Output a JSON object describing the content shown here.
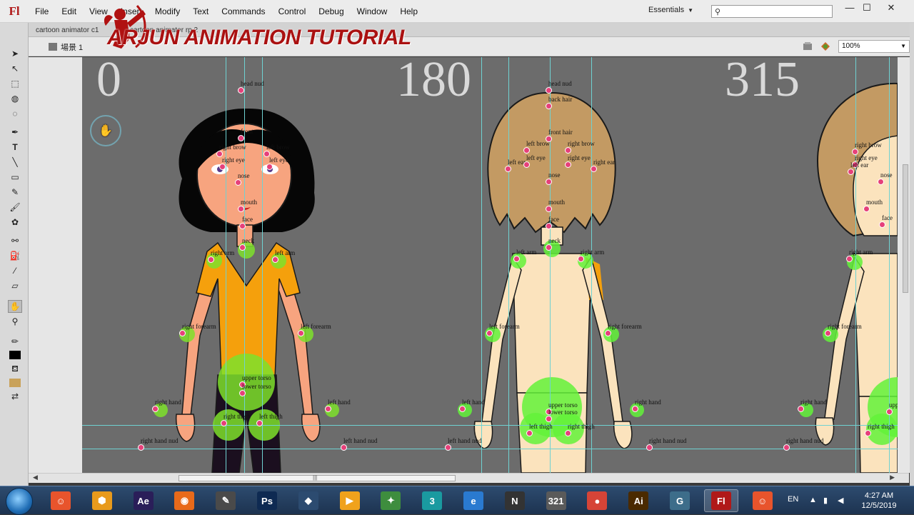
{
  "app": {
    "logo": "Fl"
  },
  "menu": [
    "File",
    "Edit",
    "View",
    "Insert",
    "Modify",
    "Text",
    "Commands",
    "Control",
    "Debug",
    "Window",
    "Help"
  ],
  "workspace": {
    "label": "Essentials"
  },
  "search": {
    "placeholder": ""
  },
  "window_controls": {
    "minimize": "—",
    "maximize": "☐",
    "close": "✕"
  },
  "doc_tabs": [
    "cartoon animator c1",
    "cartoon animator rp 2"
  ],
  "scene": {
    "label": "場景 1"
  },
  "zoom": {
    "value": "100%"
  },
  "watermark": {
    "text": "ARJUN ANIMATION TUTORIAL"
  },
  "stage": {
    "angles": [
      "0",
      "180",
      "315"
    ],
    "figures": [
      {
        "labels": [
          "head nud",
          "front",
          "right brow",
          "left brow",
          "right eye",
          "left eye",
          "nose",
          "mouth",
          "face",
          "neck",
          "right arm",
          "left arm",
          "right forearm",
          "left forearm",
          "upper torso",
          "lower torso",
          "right thigh",
          "left thigh",
          "right hand",
          "left hand",
          "right hand nud",
          "left hand nud"
        ]
      },
      {
        "labels": [
          "head nud",
          "back hair",
          "front hair",
          "left brow",
          "right brow",
          "left ear",
          "left eye",
          "right eye",
          "right ear",
          "nose",
          "mouth",
          "face",
          "neck",
          "left arm",
          "right arm",
          "left forearm",
          "right forearm",
          "upper torso",
          "lower torso",
          "left thigh",
          "right thigh",
          "left hand",
          "right hand",
          "left hand nud",
          "right hand nud"
        ]
      },
      {
        "labels": [
          "right brow",
          "right eye",
          "left ear",
          "nose",
          "mouth",
          "face",
          "right arm",
          "right forearm",
          "right hand",
          "right hand nud",
          "right thigh",
          "upper torso"
        ]
      }
    ]
  },
  "taskbar": {
    "apps": [
      {
        "name": "cartoon-animator",
        "glyph": "☺",
        "color": "#e8542c"
      },
      {
        "name": "sketchup",
        "glyph": "⬢",
        "color": "#e89a1c"
      },
      {
        "name": "after-effects",
        "glyph": "Ae",
        "color": "#2a1e59"
      },
      {
        "name": "firefox",
        "glyph": "◉",
        "color": "#e86a1a"
      },
      {
        "name": "media",
        "glyph": "✎",
        "color": "#4a4a4a"
      },
      {
        "name": "photoshop",
        "glyph": "Ps",
        "color": "#0e2a52"
      },
      {
        "name": "app-blue",
        "glyph": "◆",
        "color": "#2c4b70"
      },
      {
        "name": "media-player",
        "glyph": "▶",
        "color": "#f0a21c"
      },
      {
        "name": "android-studio",
        "glyph": "✦",
        "color": "#3e8d3e"
      },
      {
        "name": "3ds-max",
        "glyph": "3",
        "color": "#1a9aa0"
      },
      {
        "name": "internet-explorer",
        "glyph": "e",
        "color": "#2a7ad0"
      },
      {
        "name": "nuke",
        "glyph": "N",
        "color": "#333333"
      },
      {
        "name": "video-editor",
        "glyph": "321",
        "color": "#5a5a5a"
      },
      {
        "name": "chrome",
        "glyph": "●",
        "color": "#d64437"
      },
      {
        "name": "illustrator",
        "glyph": "Ai",
        "color": "#4a2a00"
      },
      {
        "name": "app-g",
        "glyph": "G",
        "color": "#3d6d8a"
      },
      {
        "name": "flash",
        "glyph": "Fl",
        "color": "#b01919"
      },
      {
        "name": "cartoon-animator-2",
        "glyph": "☺",
        "color": "#e8542c"
      }
    ],
    "lang": "EN",
    "time": "4:27 AM",
    "date": "12/5/2019"
  }
}
